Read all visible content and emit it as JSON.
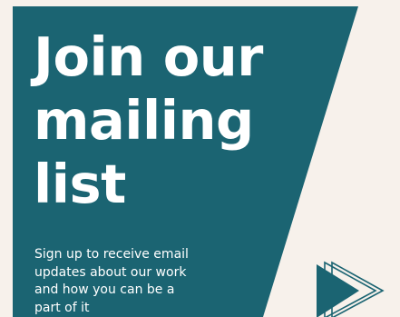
{
  "headline": {
    "lines": [
      "Join our",
      "mailing",
      "list"
    ]
  },
  "subtext": {
    "lines": [
      "Sign up to receive email",
      "updates about our work",
      "and how you can be a",
      "part of it"
    ]
  },
  "colors": {
    "teal": "#1b6472",
    "cream": "#f7f1eb",
    "text": "#ffffff"
  },
  "icons": {
    "arrow": "play-arrow-icon"
  }
}
